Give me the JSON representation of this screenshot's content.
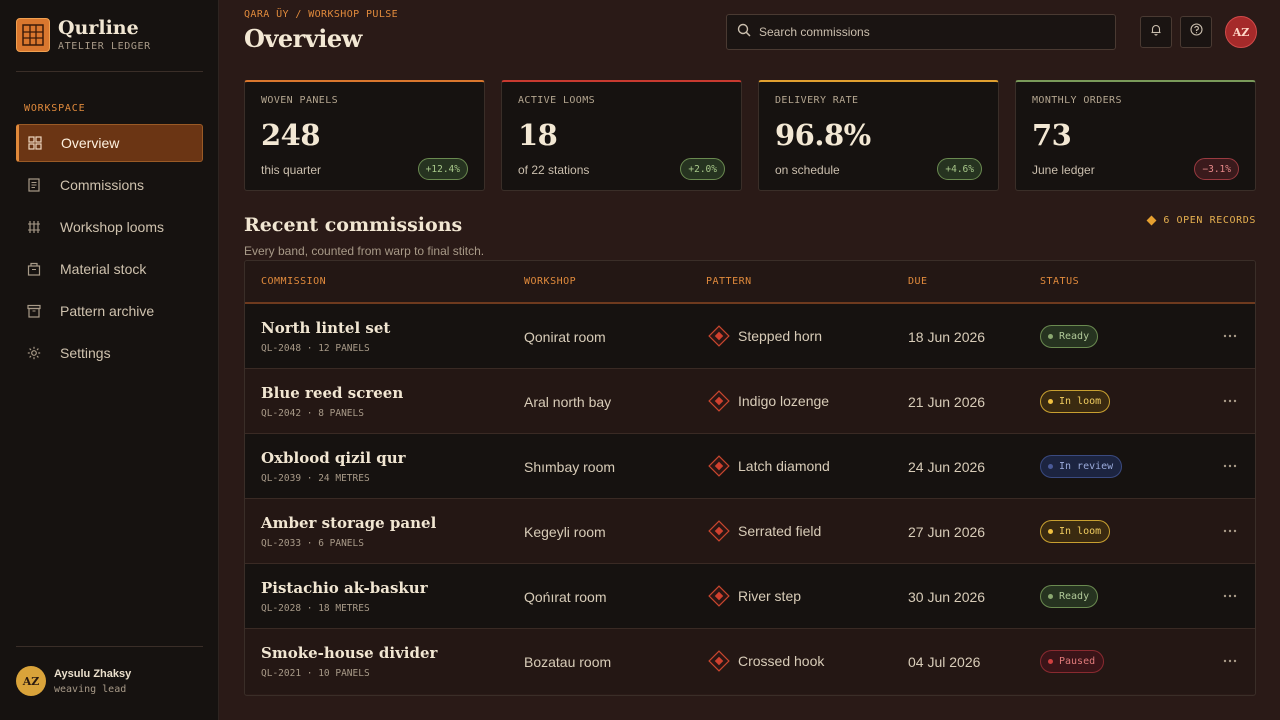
{
  "brand": {
    "name": "Qurline",
    "subtitle": "ATELIER LEDGER"
  },
  "sidebar": {
    "section_label": "WORKSPACE",
    "items": [
      {
        "label": "Overview",
        "icon": "grid-icon",
        "active": true
      },
      {
        "label": "Commissions",
        "icon": "document-icon",
        "active": false
      },
      {
        "label": "Workshop looms",
        "icon": "loom-icon",
        "active": false
      },
      {
        "label": "Material stock",
        "icon": "box-icon",
        "active": false
      },
      {
        "label": "Pattern archive",
        "icon": "archive-icon",
        "active": false
      },
      {
        "label": "Settings",
        "icon": "gear-icon",
        "active": false
      }
    ]
  },
  "user": {
    "initials": "AZ",
    "name": "Aysulu Zhaksy",
    "role": "weaving lead"
  },
  "header": {
    "breadcrumb": "QARA ÜY / WORKSHOP PULSE",
    "title": "Overview",
    "search_placeholder": "Search commissions",
    "avatar_initials": "AZ"
  },
  "kpis": [
    {
      "label": "WOVEN PANELS",
      "value": "248",
      "sub": "this quarter",
      "delta": "+12.4%",
      "trend": "up",
      "accent": "#d9772e"
    },
    {
      "label": "ACTIVE LOOMS",
      "value": "18",
      "sub": "of 22 stations",
      "delta": "+2.0%",
      "trend": "up",
      "accent": "#c83a30"
    },
    {
      "label": "DELIVERY RATE",
      "value": "96.8%",
      "sub": "on schedule",
      "delta": "+4.6%",
      "trend": "up",
      "accent": "#e0a030"
    },
    {
      "label": "MONTHLY ORDERS",
      "value": "73",
      "sub": "June ledger",
      "delta": "−3.1%",
      "trend": "down",
      "accent": "#7a9a5a"
    }
  ],
  "section": {
    "title": "Recent commissions",
    "subtitle": "Every band, counted from warp to final stitch.",
    "open_records": "6 OPEN RECORDS"
  },
  "table": {
    "headers": [
      "COMMISSION",
      "WORKSHOP",
      "PATTERN",
      "DUE",
      "STATUS"
    ],
    "rows": [
      {
        "name": "North lintel set",
        "code": "QL-2048 · 12 PANELS",
        "workshop": "Qonirat room",
        "pattern": "Stepped horn",
        "due": "18 Jun 2026",
        "status": "Ready",
        "status_kind": "ready"
      },
      {
        "name": "Blue reed screen",
        "code": "QL-2042 · 8 PANELS",
        "workshop": "Aral north bay",
        "pattern": "Indigo lozenge",
        "due": "21 Jun 2026",
        "status": "In loom",
        "status_kind": "loom"
      },
      {
        "name": "Oxblood qizil qur",
        "code": "QL-2039 · 24 METRES",
        "workshop": "Shımbay room",
        "pattern": "Latch diamond",
        "due": "24 Jun 2026",
        "status": "In review",
        "status_kind": "review"
      },
      {
        "name": "Amber storage panel",
        "code": "QL-2033 · 6 PANELS",
        "workshop": "Kegeyli room",
        "pattern": "Serrated field",
        "due": "27 Jun 2026",
        "status": "In loom",
        "status_kind": "loom"
      },
      {
        "name": "Pistachio ak-baskur",
        "code": "QL-2028 · 18 METRES",
        "workshop": "Qońırat room",
        "pattern": "River step",
        "due": "30 Jun 2026",
        "status": "Ready",
        "status_kind": "ready"
      },
      {
        "name": "Smoke-house divider",
        "code": "QL-2021 · 10 PANELS",
        "workshop": "Bozatau room",
        "pattern": "Crossed hook",
        "due": "04 Jul 2026",
        "status": "Paused",
        "status_kind": "paused"
      }
    ]
  }
}
